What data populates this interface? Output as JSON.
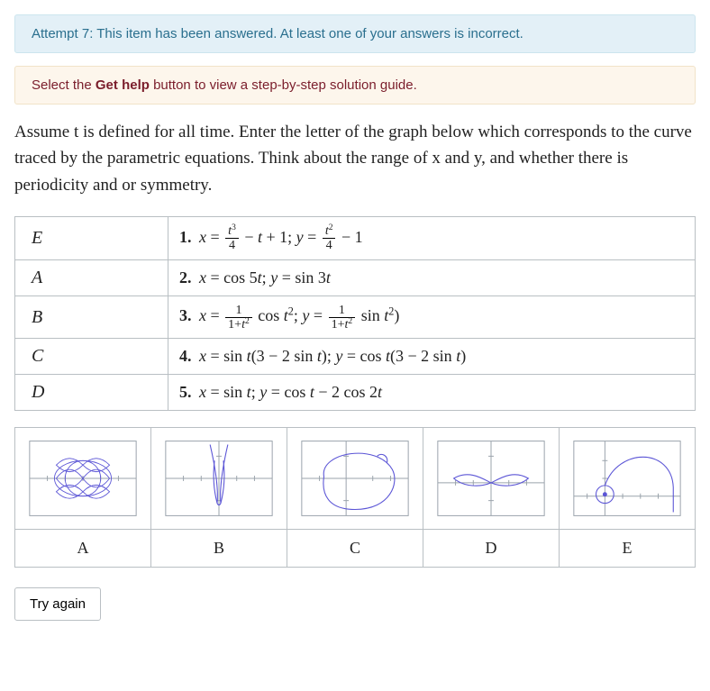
{
  "alerts": {
    "attempt": "Attempt 7: This item has been answered. At least one of your answers is incorrect.",
    "help_pre": "Select the ",
    "help_bold": "Get help",
    "help_post": " button to view a step-by-step solution guide."
  },
  "question": "Assume t is defined for all time. Enter the letter of the graph below which corresponds to the curve traced by the parametric equations. Think about the range of x and y, and whether there is periodicity and or symmetry.",
  "rows": [
    {
      "answer": "E",
      "num": "1.",
      "eq_html": "<i>x</i> = <span class='frac'><span class='top'><i>t</i><sup>3</sup></span><span class='bot'>4</span></span> − <i>t</i> + 1; <i>y</i> = <span class='frac'><span class='top'><i>t</i><sup>2</sup></span><span class='bot'>4</span></span> − 1"
    },
    {
      "answer": "A",
      "num": "2.",
      "eq_html": "<i>x</i> = cos 5<i>t</i>; <i>y</i> = sin 3<i>t</i>"
    },
    {
      "answer": "B",
      "num": "3.",
      "eq_html": "<i>x</i> = <span class='frac'><span class='top'>1</span><span class='bot'>1+<i>t</i><sup>2</sup></span></span> cos <i>t</i><sup>2</sup>; <i>y</i> = <span class='frac'><span class='top'>1</span><span class='bot'>1+<i>t</i><sup>2</sup></span></span> sin <i>t</i><sup>2</sup>)"
    },
    {
      "answer": "C",
      "num": "4.",
      "eq_html": "<i>x</i> = sin <i>t</i>(3 − 2 sin <i>t</i>); <i>y</i> = cos <i>t</i>(3 − 2 sin <i>t</i>)"
    },
    {
      "answer": "D",
      "num": "5.",
      "eq_html": "<i>x</i> = sin <i>t</i>; <i>y</i> = cos <i>t</i> − 2 cos 2<i>t</i>"
    }
  ],
  "graph_labels": [
    "A",
    "B",
    "C",
    "D",
    "E"
  ],
  "button": {
    "try_again": "Try again"
  }
}
